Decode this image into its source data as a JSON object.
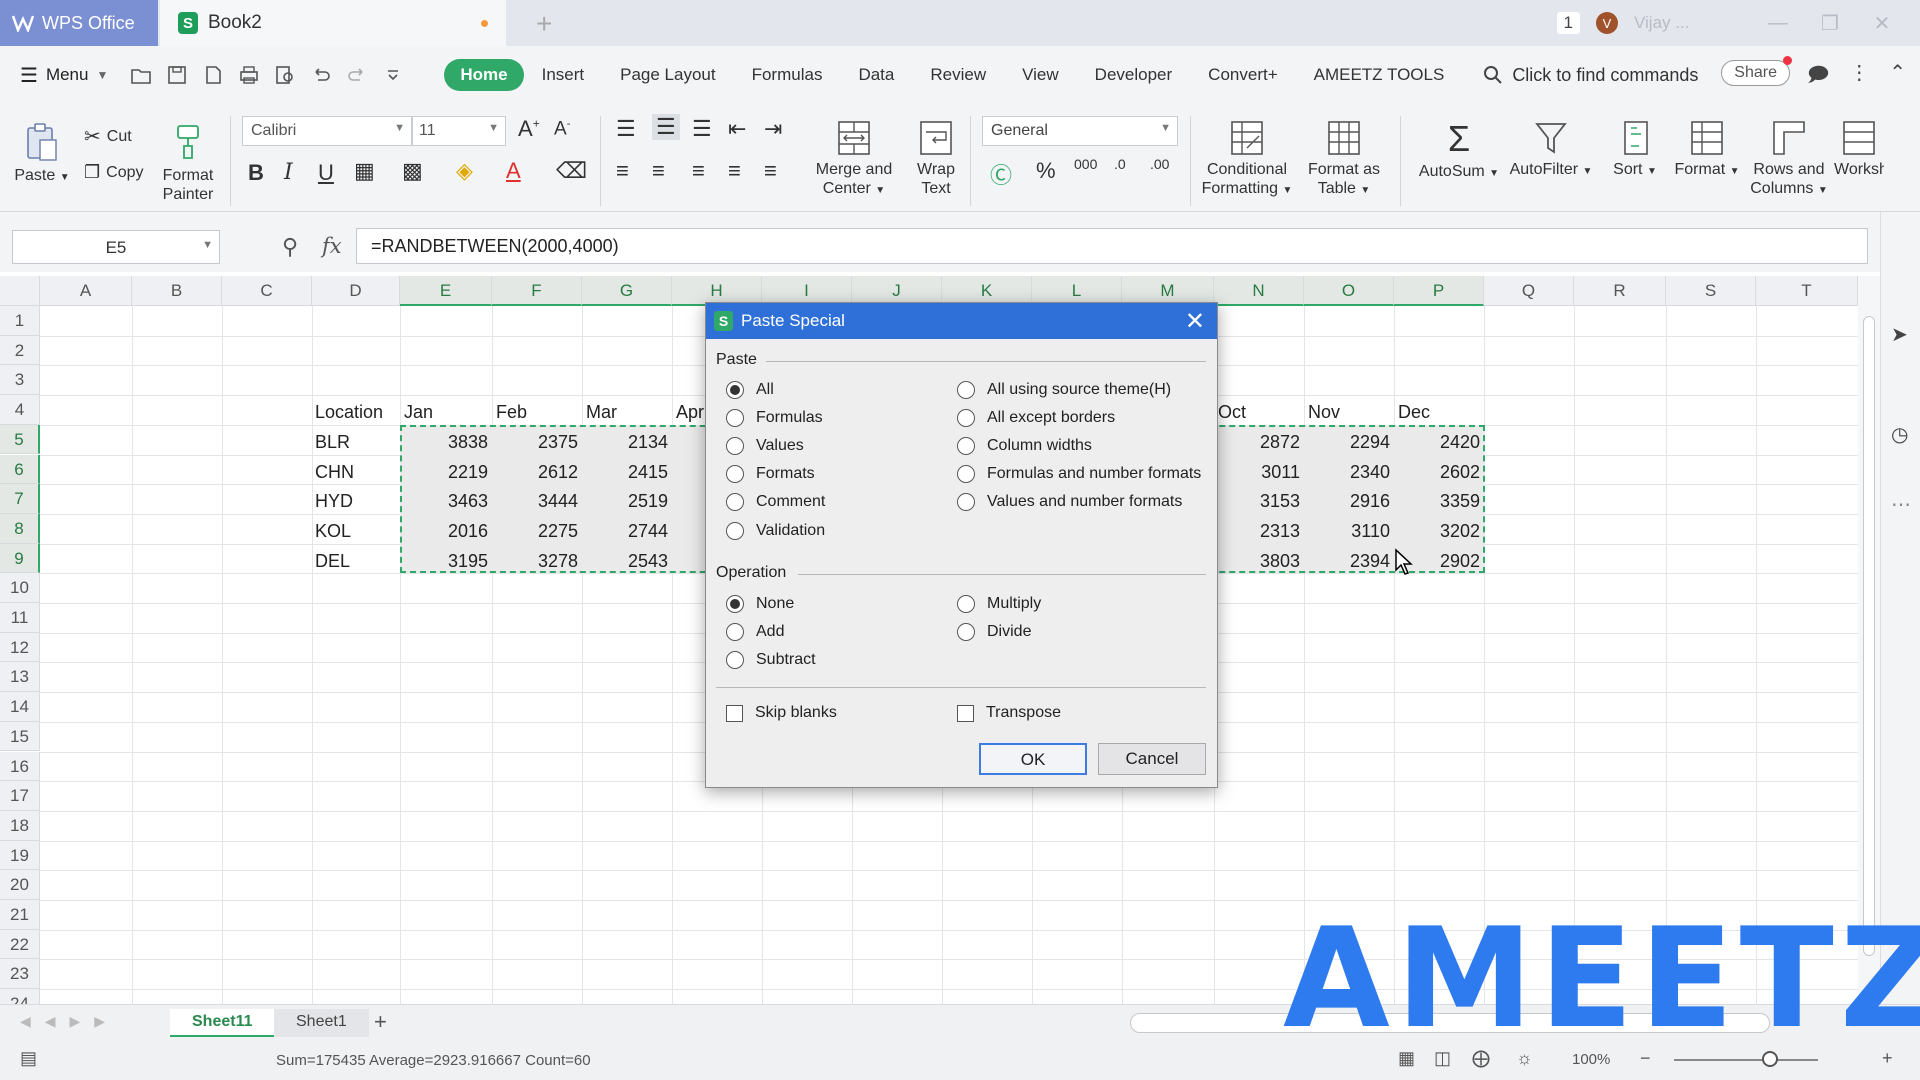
{
  "app": {
    "name": "WPS Office",
    "document": "Book2",
    "notification_count": "1",
    "user_initial": "V",
    "user_name": "Vijay ..."
  },
  "menubar": {
    "menu_label": "Menu",
    "tabs": [
      "Home",
      "Insert",
      "Page Layout",
      "Formulas",
      "Data",
      "Review",
      "View",
      "Developer",
      "Convert+",
      "AMEETZ TOOLS"
    ],
    "active_tab": "Home",
    "search_label": "Click to find commands",
    "share_label": "Share"
  },
  "ribbon": {
    "paste": "Paste",
    "cut": "Cut",
    "copy": "Copy",
    "format_painter_1": "Format",
    "format_painter_2": "Painter",
    "font": "Calibri",
    "font_size": "11",
    "merge_1": "Merge and",
    "merge_2": "Center",
    "wrap_1": "Wrap",
    "wrap_2": "Text",
    "number_format": "General",
    "cond_1": "Conditional",
    "cond_2": "Formatting",
    "fmt_table_1": "Format as",
    "fmt_table_2": "Table",
    "autosum": "AutoSum",
    "autofilter": "AutoFilter",
    "sort": "Sort",
    "format": "Format",
    "rows_cols_1": "Rows and",
    "rows_cols_2": "Columns",
    "worksheet": "Worksh"
  },
  "formula_bar": {
    "name_box": "E5",
    "formula": "=RANDBETWEEN(2000,4000)"
  },
  "grid": {
    "columns": [
      "A",
      "B",
      "C",
      "D",
      "E",
      "F",
      "G",
      "H",
      "I",
      "J",
      "K",
      "L",
      "M",
      "N",
      "O",
      "P",
      "Q",
      "R",
      "S",
      "T"
    ],
    "rows": [
      "1",
      "2",
      "3",
      "4",
      "5",
      "6",
      "7",
      "8",
      "9",
      "10",
      "11",
      "12",
      "13",
      "14",
      "15",
      "16",
      "17",
      "18",
      "19",
      "20",
      "21",
      "22",
      "23",
      "24"
    ],
    "header_row": {
      "location": "Location",
      "e": "Jan",
      "f": "Feb",
      "g": "Mar",
      "h": "Apr",
      "n": "Oct",
      "o": "Nov",
      "p": "Dec"
    },
    "data": [
      {
        "loc": "BLR",
        "e": "3838",
        "f": "2375",
        "g": "2134",
        "n": "2872",
        "o": "2294",
        "p": "2420"
      },
      {
        "loc": "CHN",
        "e": "2219",
        "f": "2612",
        "g": "2415",
        "n": "3011",
        "o": "2340",
        "p": "2602"
      },
      {
        "loc": "HYD",
        "e": "3463",
        "f": "3444",
        "g": "2519",
        "n": "3153",
        "o": "2916",
        "p": "3359"
      },
      {
        "loc": "KOL",
        "e": "2016",
        "f": "2275",
        "g": "2744",
        "n": "2313",
        "o": "3110",
        "p": "3202"
      },
      {
        "loc": "DEL",
        "e": "3195",
        "f": "3278",
        "g": "2543",
        "n": "3803",
        "o": "2394",
        "p": "2902"
      }
    ]
  },
  "dialog": {
    "title": "Paste Special",
    "paste_group": "Paste",
    "paste_options_left": [
      "All",
      "Formulas",
      "Values",
      "Formats",
      "Comment",
      "Validation"
    ],
    "paste_options_right": [
      "All using source theme(H)",
      "All except borders",
      "Column widths",
      "Formulas and number formats",
      "Values and number formats"
    ],
    "operation_group": "Operation",
    "operation_left": [
      "None",
      "Add",
      "Subtract"
    ],
    "operation_right": [
      "Multiply",
      "Divide"
    ],
    "skip_blanks": "Skip blanks",
    "transpose": "Transpose",
    "ok": "OK",
    "cancel": "Cancel"
  },
  "sheets": {
    "active": "Sheet11",
    "other": "Sheet1"
  },
  "status": {
    "summary": "Sum=175435  Average=2923.916667  Count=60",
    "zoom": "100%"
  },
  "watermark": "AMEETZ",
  "colors": {
    "accent_green": "#2fa868",
    "dialog_blue": "#2e70d8",
    "wps_tab": "#7b8fd3",
    "watermark_blue": "#2e7bef"
  }
}
